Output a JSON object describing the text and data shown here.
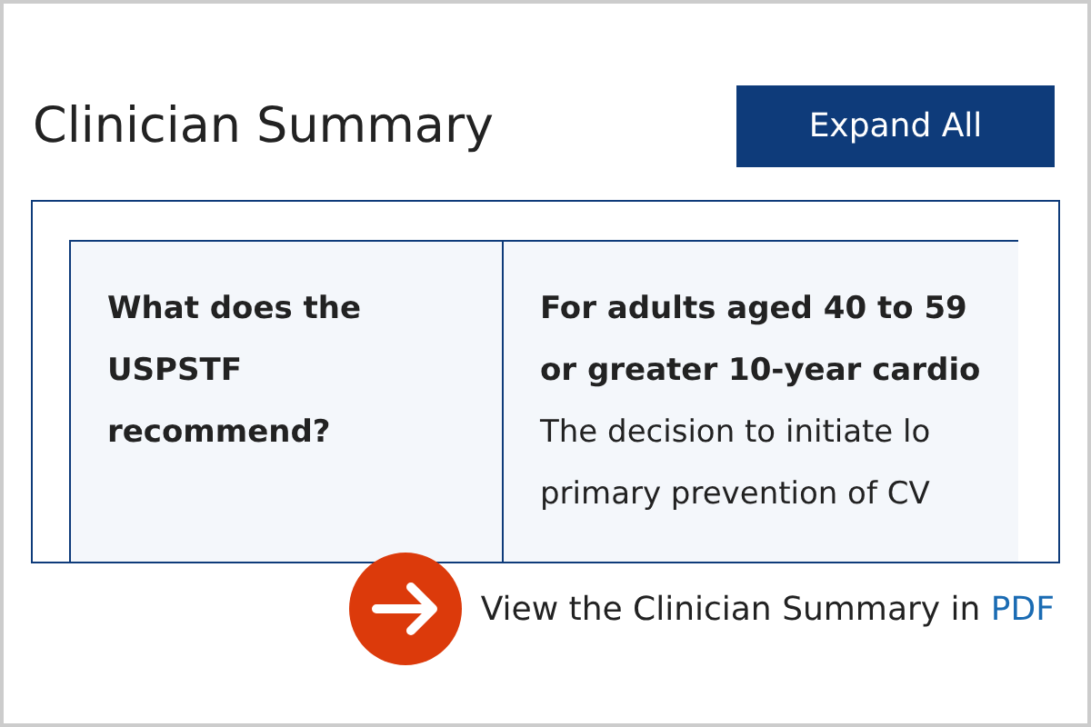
{
  "title": "Clinician Summary",
  "expand_button": "Expand All",
  "table": {
    "question": [
      "What does the",
      "USPSTF",
      "recommend?"
    ],
    "answer": [
      {
        "kind": "bold",
        "text": "For adults aged 40 to 59"
      },
      {
        "kind": "bold",
        "text": "or greater 10-year cardio"
      },
      {
        "kind": "normal",
        "text": "The decision to initiate lo"
      },
      {
        "kind": "normal",
        "text": "primary prevention of CV"
      }
    ]
  },
  "footer": {
    "text": "View the Clinician Summary in",
    "link": "PDF"
  }
}
